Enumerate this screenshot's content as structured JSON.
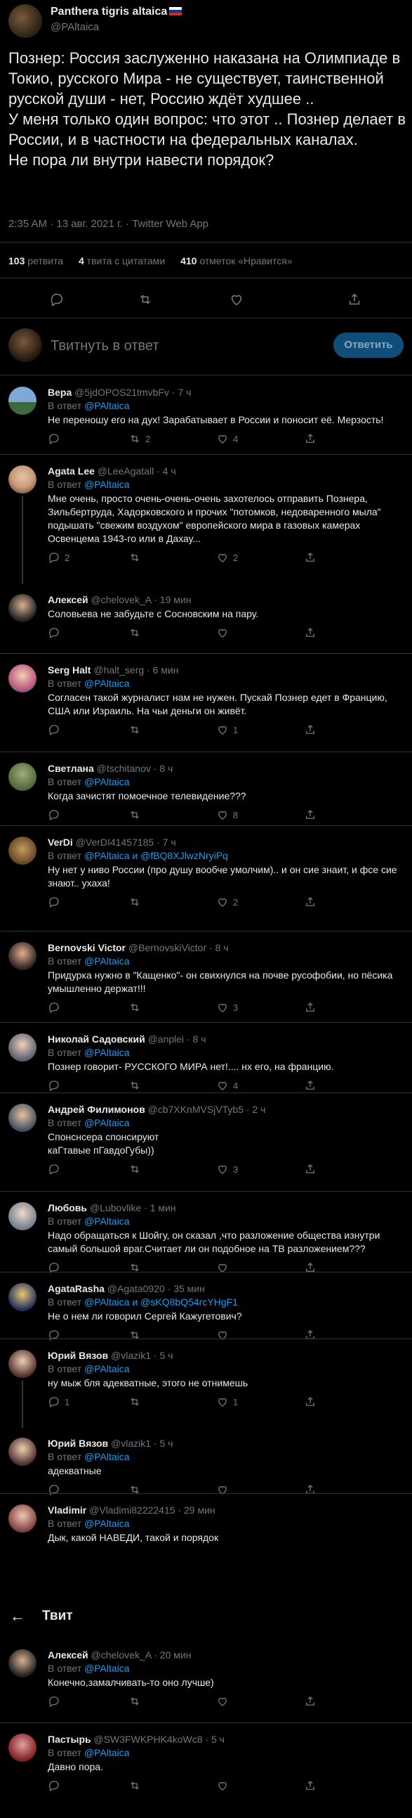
{
  "tweet": {
    "name": "Panthera tigris altaica",
    "handle": "@PAltaica",
    "text": "Познер: Россия заслуженно наказана на Олимпиаде в Токио, русского Мира - не существует, таинственной русской души - нет, Россию ждёт худшее ..\nУ меня только один вопрос: что этот .. Познер делает в России, и в частности на федеральных каналах.\nНе пора ли внутри навести порядок?",
    "meta": "2:35 AM · 13 авг. 2021 г. · Twitter Web App",
    "retweets_count": "103",
    "retweets_label": "ретвита",
    "quotes_count": "4",
    "quotes_label": "твита с цитатами",
    "likes_count": "410",
    "likes_label": "отметок «Нравится»"
  },
  "compose": {
    "placeholder": "Твитнуть в ответ",
    "button": "Ответить"
  },
  "colors": {
    "accent": "#1d9bf0",
    "background": "#000000",
    "muted": "#71767b"
  },
  "replies": [
    {
      "name": "Вера",
      "handle": "@5jdOPOS21tmvbFv",
      "time": "7 ч",
      "in_reply": "В ответ",
      "to": "@PAltaica",
      "text": "Не переношу его на дух! Зарабатывает в России и поносит её. Мерзость!",
      "retweets": "2",
      "likes": "4"
    },
    {
      "name": "Agata Lee",
      "handle": "@LeeAgatall",
      "time": "4 ч",
      "in_reply": "В ответ",
      "to": "@PAltaica",
      "text": "Мне очень, просто очень-очень-очень захотелось отправить Познера, Зильбертруда, Хадорковского и прочих \"потомков, недоваренного мыла\"  подышать \"свежим воздухом\" европейского мира в газовых камерах Освенцема 1943-го или в Дахау...",
      "replies": "2",
      "likes": "2"
    },
    {
      "name": "Алексей",
      "handle": "@chelovek_A",
      "time": "19 мин",
      "text": "Соловьева не забудьте с Сосновским на пару."
    },
    {
      "name": "Serg Halt",
      "handle": "@halt_serg",
      "time": "6 мин",
      "in_reply": "В ответ",
      "to": "@PAltaica",
      "text": "Согласен такой журналист нам не нужен. Пускай Познер едет в Францию, США или Израиль. На чьи деньги он живёт.",
      "likes": "1"
    },
    {
      "name": "Светлана",
      "handle": "@tschitanov",
      "time": "8 ч",
      "in_reply": "В ответ",
      "to": "@PAltaica",
      "text": "Когда зачистят помоечное телевидение???",
      "likes": "8"
    },
    {
      "name": "VerDi",
      "handle": "@VerDI41457185",
      "time": "7 ч",
      "in_reply": "В ответ",
      "to": "@PAltaica и @fBQ8XJlwzNryiPq",
      "text": "Ну нет у ниво России (про душу вообче умолчим).. и он сие знаит, и фсе сие знают.. ухаха!",
      "likes": "2"
    },
    {
      "name": "Bernovski Victor",
      "handle": "@BernovskiVictor",
      "time": "8 ч",
      "in_reply": "В ответ",
      "to": "@PAltaica",
      "text": "Придурка нужно в \"Кащенко\"- он свихнулся на почве русофобии, но пёсика умышленно держат!!!",
      "likes": "3"
    },
    {
      "name": "Николай Садовский",
      "handle": "@anplei",
      "time": "8 ч",
      "in_reply": "В ответ",
      "to": "@PAltaica",
      "text": "Познер говорит- РУССКОГО МИРА нет!.... нх его, на францию.",
      "likes": "4"
    },
    {
      "name": "Андрей Филимонов",
      "handle": "@cb7XKnMVSjVTyb5",
      "time": "2 ч",
      "in_reply": "В ответ",
      "to": "@PAltaica",
      "text": "Спонснсера спонсируют\nкаГтавые пГавдоГубы))",
      "likes": "3"
    },
    {
      "name": "Любовь",
      "handle": "@Lubovlike",
      "time": "1 мин",
      "in_reply": "В ответ",
      "to": "@PAltaica",
      "text": "Надо обращаться к Шойгу, он сказал ,что разложение общества изнутри самый большой враг.Считает ли он подобное на ТВ разложением???"
    },
    {
      "name": "AgataRasha",
      "handle": "@Agata0920",
      "time": "35 мин",
      "in_reply": "В ответ",
      "to": "@PAltaica и @sKQ8bQ54rcYHgF1",
      "text": "Не о нем ли говорил Сергей Кажугетович?"
    },
    {
      "name": "Юрий Вязов",
      "handle": "@vlazik1",
      "time": "5 ч",
      "in_reply": "В ответ",
      "to": "@PAltaica",
      "text": "ну мыж бля адекватные, этого не отнимешь",
      "replies": "1",
      "likes": "1"
    },
    {
      "name": "Юрий Вязов",
      "handle": "@vlazik1",
      "time": "5 ч",
      "in_reply": "В ответ",
      "to": "@PAltaica",
      "text": "адекватные"
    },
    {
      "name": "Vladimir",
      "handle": "@Vladimi82222415",
      "time": "29 мин",
      "in_reply": "В ответ",
      "to": "@PAltaica",
      "text": "Дык, какой НАВЕДИ, такой и порядок"
    },
    {
      "name": "Алексей",
      "handle": "@chelovek_A",
      "time": "20 мин",
      "in_reply": "В ответ",
      "to": "@PAltaica",
      "text": "Конечно,замалчивать-то оно лучше)"
    },
    {
      "name": "Пастырь",
      "handle": "@SW3FWKPHK4koWc8",
      "time": "5 ч",
      "in_reply": "В ответ",
      "to": "@PAltaica",
      "text": "Давно пора."
    }
  ],
  "overlay_header": {
    "title": "Твит"
  }
}
